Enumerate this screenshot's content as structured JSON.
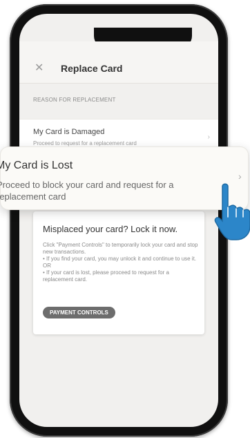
{
  "header": {
    "close_icon": "close-icon",
    "title": "Replace Card"
  },
  "section_label": "REASON FOR REPLACEMENT",
  "options": [
    {
      "title": "My Card is Damaged",
      "subtitle": "Proceed to request for a replacement card"
    },
    {
      "title": "My Card is Lost",
      "subtitle": "Proceed to block your card and request for a replacement card",
      "highlighted": true
    }
  ],
  "lock_card": {
    "title": "Misplaced your card? Lock it now.",
    "body": [
      "Click \"Payment Controls\" to temporarily lock your card and stop new transactions.",
      "• If you find your card, you may unlock it and continue to use it. OR",
      "• If your card is lost, please proceed to request for a replacement card."
    ],
    "button_label": "PAYMENT CONTROLS"
  },
  "icons": [
    "close-icon",
    "chevron-right-icon",
    "pointing-hand-icon"
  ],
  "colors": {
    "button_bg": "#6d6d6d",
    "hand": "#2c86c9",
    "phone_frame": "#101010"
  }
}
